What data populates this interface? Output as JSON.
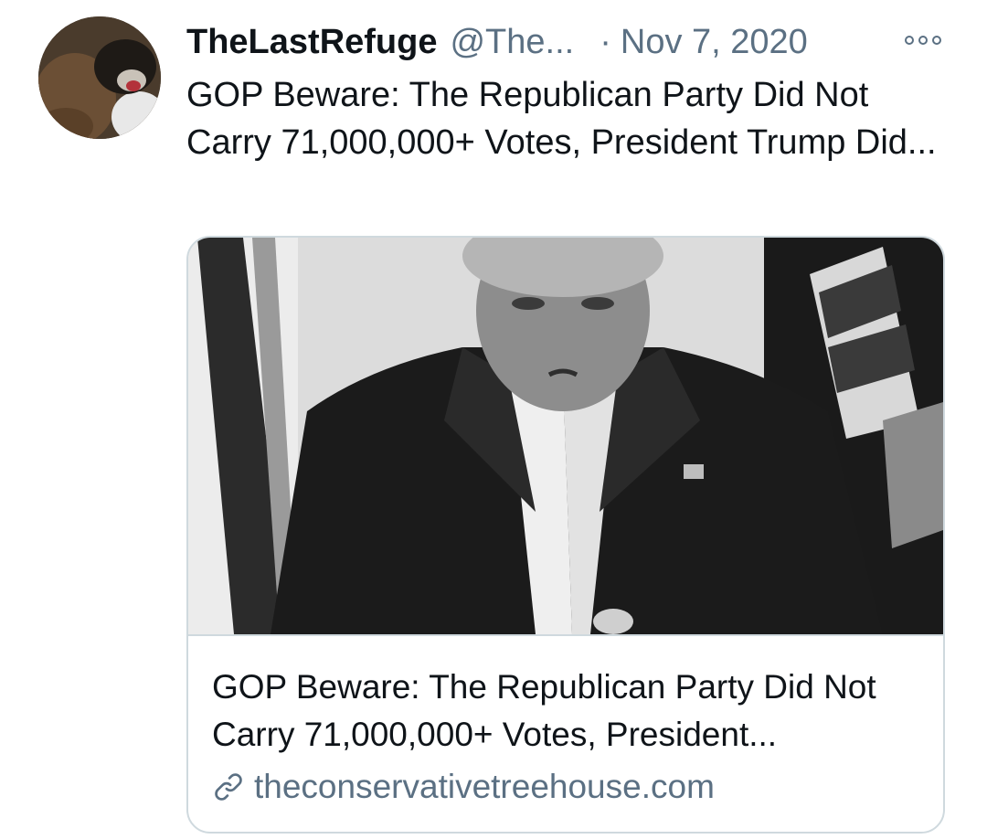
{
  "tweet": {
    "author_name": "TheLastRefuge",
    "author_handle": "@The...",
    "separator": "·",
    "date": "Nov 7, 2020",
    "more_icon": "more-options-icon",
    "text": "GOP Beware: The Republican Party Did Not Carry 71,000,000+ Votes, President Trump Did...",
    "card": {
      "title": "GOP Beware: The Republican Party Did Not Carry 71,000,000+ Votes, President...",
      "domain": "theconservativetreehouse.com",
      "link_icon": "link-icon"
    }
  },
  "colors": {
    "text_primary": "#0f1419",
    "text_secondary": "#5b7083",
    "card_border": "#cfd9de",
    "background": "#ffffff"
  }
}
